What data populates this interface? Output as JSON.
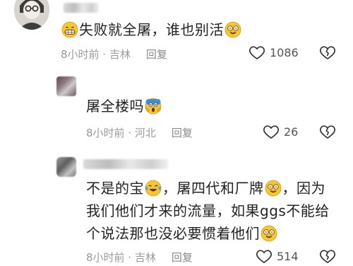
{
  "comments": [
    {
      "text_before": "失败就全屠，谁也别活",
      "meta_time": "8小时前 · 吉林",
      "reply_label": "回复",
      "like_count": "1086"
    },
    {
      "text_before": "屠全楼吗",
      "meta_time": "8小时前 · 河北",
      "reply_label": "回复",
      "like_count": "26"
    },
    {
      "line1_a": "不是的宝",
      "line1_b": "，屠四代和厂牌",
      "line1_c": "，因为",
      "line2": "我们他们才来的流量，如果ggs不能给",
      "line3": "个说法那也没必要惯着他们",
      "meta_time": "8小时前 · 吉林",
      "reply_label": "回复",
      "like_count": "514"
    }
  ],
  "icons": {
    "like": "heart-outline-icon",
    "dislike": "broken-heart-icon",
    "emoji_grin": "grinning-emoji-icon",
    "emoji_star": "star-eyes-emoji-icon",
    "emoji_scream": "screaming-emoji-icon",
    "emoji_cry": "crying-laughing-emoji-icon"
  }
}
